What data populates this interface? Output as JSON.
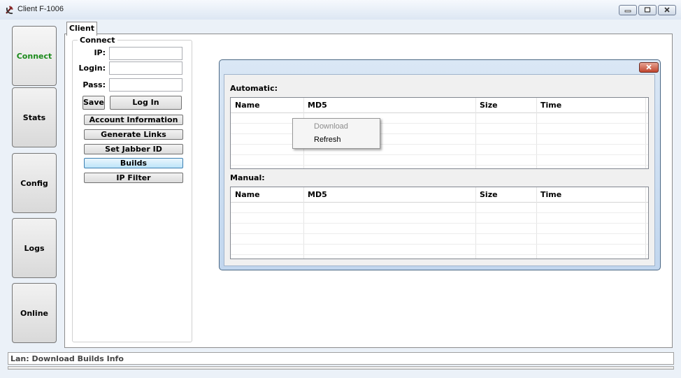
{
  "window": {
    "title": "Client F-1006",
    "icon": "hammer-sickle-icon",
    "controls": [
      "minimize-icon",
      "maximize-icon",
      "close-icon"
    ]
  },
  "sidebar": {
    "items": [
      {
        "label": "Connect",
        "active": true
      },
      {
        "label": "Stats"
      },
      {
        "label": "Config"
      },
      {
        "label": "Logs"
      },
      {
        "label": "Online"
      }
    ],
    "active_color": "#1a8a1a"
  },
  "tabs": [
    {
      "label": "Client",
      "selected": true
    }
  ],
  "connect": {
    "group_label": "Connect",
    "ip_label": "IP:",
    "ip_value": "",
    "login_label": "Login:",
    "login_value": "",
    "pass_label": "Pass:",
    "pass_value": "",
    "save_label": "Save",
    "login_button": "Log In",
    "buttons": [
      "Account Information",
      "Generate Links",
      "Set Jabber ID",
      "Builds",
      "IP Filter"
    ],
    "focused_button": "Builds"
  },
  "builds_dialog": {
    "close_icon": "close-icon",
    "automatic_label": "Automatic:",
    "manual_label": "Manual:",
    "columns": [
      "Name",
      "MD5",
      "Size",
      "Time"
    ],
    "automatic_rows": [],
    "manual_rows": []
  },
  "context_menu": {
    "items": [
      {
        "label": "Download",
        "disabled": true
      },
      {
        "label": "Refresh",
        "disabled": false
      }
    ]
  },
  "status": {
    "text": "Lan: Download Builds Info",
    "progress": 0
  }
}
